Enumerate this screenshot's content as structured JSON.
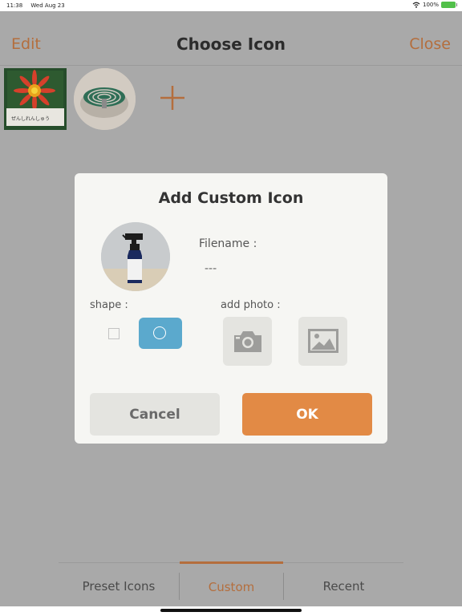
{
  "status_bar": {
    "time": "11:38",
    "date": "Wed Aug 23",
    "battery": "100%",
    "battery_color": "#52c04a",
    "icons": [
      "wifi-icon",
      "battery-icon"
    ]
  },
  "nav": {
    "edit_label": "Edit",
    "title": "Choose Icon",
    "close_label": "Close",
    "accent_color": "#b46e3d"
  },
  "icon_strip": {
    "items": [
      {
        "name": "flower-photo",
        "caption": "ぜんしれんしゅう"
      },
      {
        "name": "mosquito-coil-photo"
      }
    ],
    "add_icon": "plus-icon"
  },
  "dialog": {
    "title": "Add Custom Icon",
    "preview_name": "spray-bottle-photo",
    "filename_label": "Filename :",
    "filename_value": "---",
    "shape_label": "shape :",
    "shape_options": [
      "square",
      "circle"
    ],
    "shape_selected": "circle",
    "add_photo_label": "add photo :",
    "photo_sources": [
      "camera-icon",
      "gallery-icon"
    ],
    "cancel_label": "Cancel",
    "ok_label": "OK",
    "ok_color": "#e28a45",
    "selected_color": "#5ba9cd"
  },
  "tabs": [
    {
      "label": "Preset Icons",
      "active": false
    },
    {
      "label": "Custom",
      "active": true
    },
    {
      "label": "Recent",
      "active": false
    }
  ]
}
